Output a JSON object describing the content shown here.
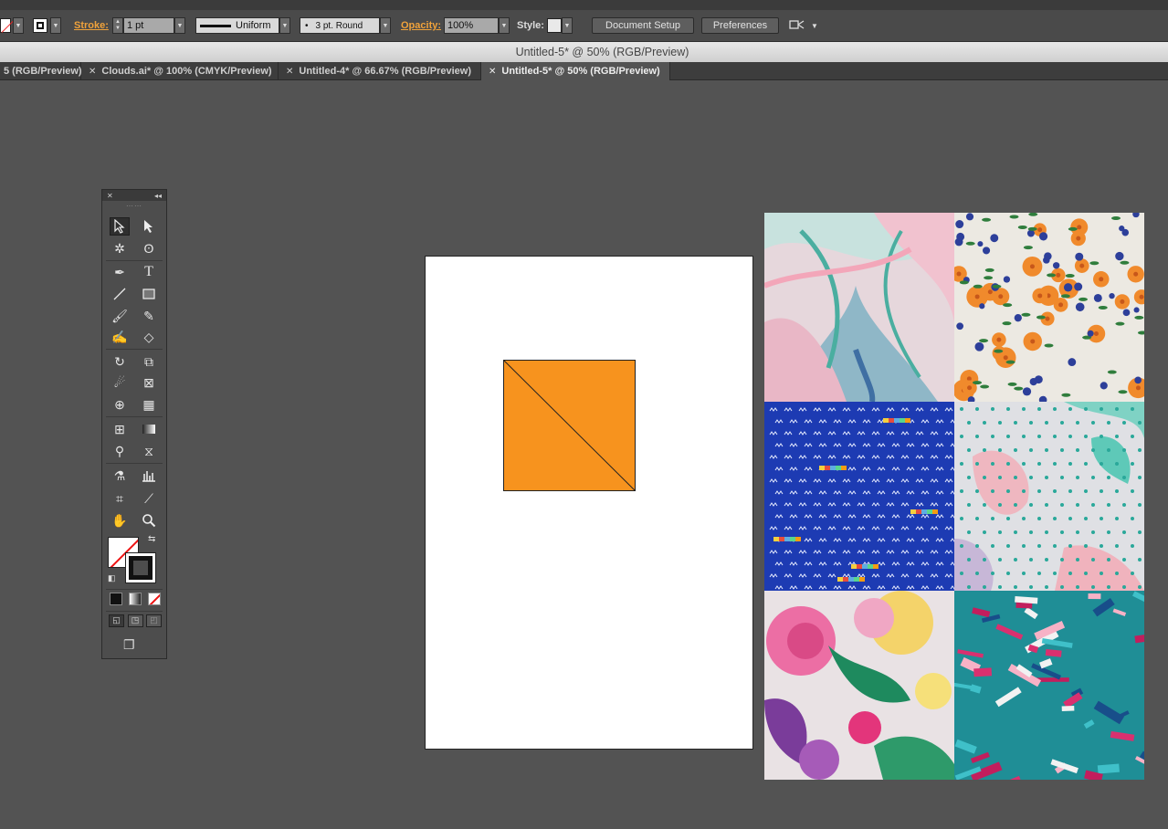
{
  "control_bar": {
    "stroke_label": "Stroke:",
    "stroke_weight": "1 pt",
    "profile_label": "Uniform",
    "brush_label": "3 pt. Round",
    "opacity_label": "Opacity:",
    "opacity_value": "100%",
    "style_label": "Style:",
    "document_setup": "Document Setup",
    "preferences": "Preferences"
  },
  "window": {
    "title": "Untitled-5* @ 50% (RGB/Preview)"
  },
  "tabs": [
    {
      "label": "5 (RGB/Preview)",
      "active": false
    },
    {
      "label": "Clouds.ai* @ 100% (CMYK/Preview)",
      "active": false
    },
    {
      "label": "Untitled-4* @ 66.67% (RGB/Preview)",
      "active": false
    },
    {
      "label": "Untitled-5* @ 50% (RGB/Preview)",
      "active": true
    }
  ],
  "tools": [
    "selection-tool",
    "direct-selection-tool",
    "magic-wand-tool",
    "lasso-tool",
    "pen-tool",
    "type-tool",
    "line-segment-tool",
    "rectangle-tool",
    "paintbrush-tool",
    "pencil-tool",
    "blob-brush-tool",
    "eraser-tool",
    "rotate-tool",
    "scale-tool",
    "warp-tool",
    "free-transform-tool",
    "shape-builder-tool",
    "perspective-grid-tool",
    "mesh-tool",
    "gradient-tool",
    "eyedropper-tool",
    "blend-tool",
    "symbol-sprayer-tool",
    "column-graph-tool",
    "artboard-tool",
    "slice-tool",
    "hand-tool",
    "zoom-tool"
  ],
  "colors": {
    "orange_fill": "#F7931E",
    "canvas": "#535353",
    "accent_label": "#F0A23B"
  }
}
